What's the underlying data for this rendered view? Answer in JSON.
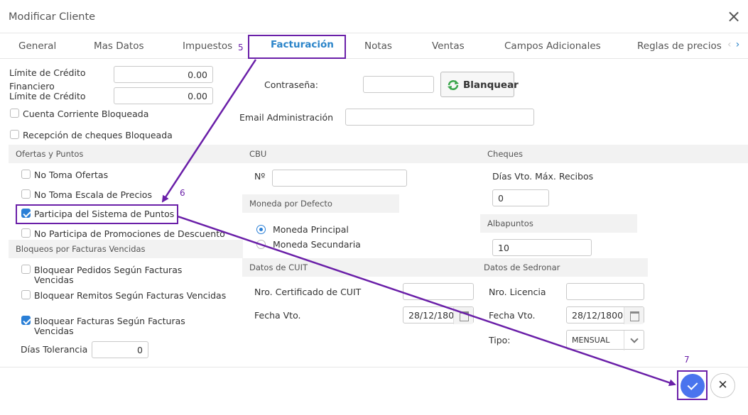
{
  "dialog": {
    "title": "Modificar Cliente",
    "close_icon": "close-icon"
  },
  "tabs": [
    "General",
    "Mas Datos",
    "Impuestos",
    "Facturación",
    "Notas",
    "Ventas",
    "Campos Adicionales",
    "Reglas de precios"
  ],
  "active_tab": "Facturación",
  "left": {
    "limite_credito_label": "Límite de Crédito",
    "limite_credito_value": "0.00",
    "financiero_label_1": "Financiero",
    "financiero_label_2": "Límite de Crédito",
    "financiero_value": "0.00",
    "cuenta_corriente": "Cuenta Corriente Bloqueada",
    "recepcion_cheques": "Recepción de cheques Bloqueada"
  },
  "security": {
    "password_label": "Contraseña:",
    "password_value": "",
    "clear_button": "Blanquear",
    "email_label": "Email Administración",
    "email_value": ""
  },
  "ofertas": {
    "section": "Ofertas y Puntos",
    "no_toma_ofertas": "No Toma Ofertas",
    "no_toma_escala": "No Toma Escala de Precios",
    "participa_puntos": "Participa del Sistema de Puntos",
    "no_participa_promos": "No Participa de Promociones de Descuento",
    "checked": {
      "no_toma_ofertas": false,
      "no_toma_escala": false,
      "participa_puntos": true,
      "no_participa_promos": false
    }
  },
  "bloqueos": {
    "section": "Bloqueos por Facturas Vencidas",
    "pedidos_1": "Bloquear Pedidos Según Facturas",
    "pedidos_2": "Vencidas",
    "remitos": "Bloquear Remitos Según Facturas Vencidas",
    "facturas_1": "Bloquear Facturas Según Facturas",
    "facturas_2": "Vencidas",
    "dias_tolerancia_label": "Días Tolerancia",
    "dias_tolerancia_value": "0",
    "checked": {
      "pedidos": false,
      "remitos": false,
      "facturas": true
    }
  },
  "cbu": {
    "section": "CBU",
    "nro_label": "Nº",
    "nro_value": ""
  },
  "moneda": {
    "section": "Moneda por Defecto",
    "principal": "Moneda Principal",
    "secundaria": "Moneda Secundaria",
    "selected": "principal"
  },
  "cheques": {
    "section": "Cheques",
    "dias_label": "Días Vto. Máx. Recibos",
    "dias_value": "0"
  },
  "albapuntos": {
    "section": "Albapuntos",
    "value": "10"
  },
  "cuit": {
    "section": "Datos de CUIT",
    "cert_label": "Nro. Certificado de CUIT",
    "cert_value": "",
    "fecha_label": "Fecha Vto.",
    "fecha_value": "28/12/180"
  },
  "sedronar": {
    "section": "Datos de Sedronar",
    "licencia_label": "Nro. Licencia",
    "licencia_value": "",
    "fecha_label": "Fecha Vto.",
    "fecha_value": "28/12/1800",
    "tipo_label": "Tipo:",
    "tipo_value": "MENSUAL"
  },
  "annotations": {
    "step5": "5",
    "step6": "6",
    "step7": "7",
    "color": "#6a1fa8"
  },
  "colors": {
    "accent": "#2a84c9",
    "confirm": "#4a74ee"
  }
}
